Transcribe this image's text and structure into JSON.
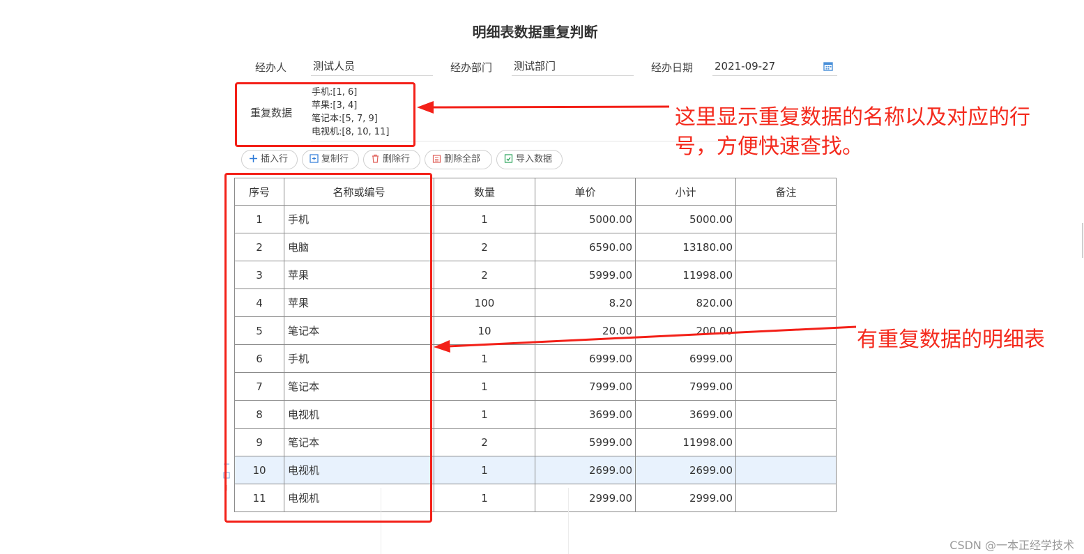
{
  "title": "明细表数据重复判断",
  "form": {
    "handler_label": "经办人",
    "handler_value": "测试人员",
    "dept_label": "经办部门",
    "dept_value": "测试部门",
    "date_label": "经办日期",
    "date_value": "2021-09-27"
  },
  "duplicates": {
    "label": "重复数据",
    "lines": [
      "手机:[1, 6]",
      "苹果:[3, 4]",
      "笔记本:[5, 7, 9]",
      "电视机:[8, 10, 11]"
    ]
  },
  "toolbar": {
    "insert_label": "插入行",
    "copy_label": "复制行",
    "delete_label": "删除行",
    "delete_all_label": "删除全部",
    "import_label": "导入数据"
  },
  "table": {
    "headers": [
      "序号",
      "名称或编号",
      "数量",
      "单价",
      "小计",
      "备注"
    ],
    "rows": [
      [
        "1",
        "手机",
        "1",
        "5000.00",
        "5000.00",
        ""
      ],
      [
        "2",
        "电脑",
        "2",
        "6590.00",
        "13180.00",
        ""
      ],
      [
        "3",
        "苹果",
        "2",
        "5999.00",
        "11998.00",
        ""
      ],
      [
        "4",
        "苹果",
        "100",
        "8.20",
        "820.00",
        ""
      ],
      [
        "5",
        "笔记本",
        "10",
        "20.00",
        "200.00",
        ""
      ],
      [
        "6",
        "手机",
        "1",
        "6999.00",
        "6999.00",
        ""
      ],
      [
        "7",
        "笔记本",
        "1",
        "7999.00",
        "7999.00",
        ""
      ],
      [
        "8",
        "电视机",
        "1",
        "3699.00",
        "3699.00",
        ""
      ],
      [
        "9",
        "笔记本",
        "2",
        "5999.00",
        "11998.00",
        ""
      ],
      [
        "10",
        "电视机",
        "1",
        "2699.00",
        "2699.00",
        ""
      ],
      [
        "11",
        "电视机",
        "1",
        "2999.00",
        "2999.00",
        ""
      ]
    ],
    "selected_row": "10"
  },
  "annotations": {
    "top_note": [
      "这里显示重复数据的名称以及对应的行",
      "号，方便快速查找。"
    ],
    "table_note": "有重复数据的明细表",
    "color": "#f32018"
  },
  "watermark": "CSDN @一本正经学技术",
  "colors": {
    "accent": "#2f7bd8",
    "selected_row_bg": "#e8f2fd"
  }
}
